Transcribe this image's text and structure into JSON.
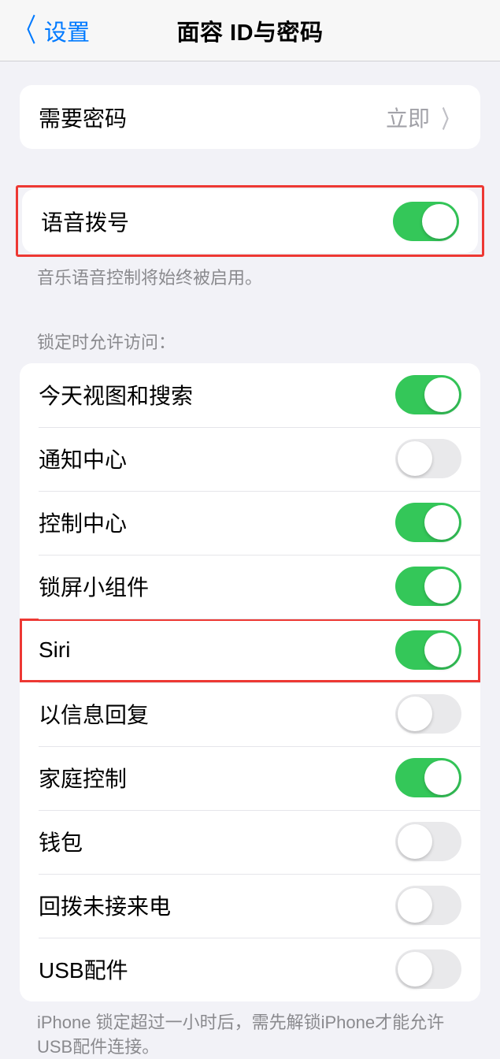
{
  "nav": {
    "back_label": "设置",
    "title": "面容 ID与密码"
  },
  "group1": {
    "require_passcode": {
      "label": "需要密码",
      "value": "立即"
    }
  },
  "group2": {
    "voice_dial": {
      "label": "语音拨号",
      "on": true
    },
    "footer": "音乐语音控制将始终被启用。"
  },
  "group3": {
    "header": "锁定时允许访问：",
    "items": [
      {
        "label": "今天视图和搜索",
        "on": true
      },
      {
        "label": "通知中心",
        "on": false
      },
      {
        "label": "控制中心",
        "on": true
      },
      {
        "label": "锁屏小组件",
        "on": true
      },
      {
        "label": "Siri",
        "on": true
      },
      {
        "label": "以信息回复",
        "on": false
      },
      {
        "label": "家庭控制",
        "on": true
      },
      {
        "label": "钱包",
        "on": false
      },
      {
        "label": "回拨未接来电",
        "on": false
      },
      {
        "label": "USB配件",
        "on": false
      }
    ],
    "footer": "iPhone 锁定超过一小时后，需先解锁iPhone才能允许USB配件连接。"
  }
}
